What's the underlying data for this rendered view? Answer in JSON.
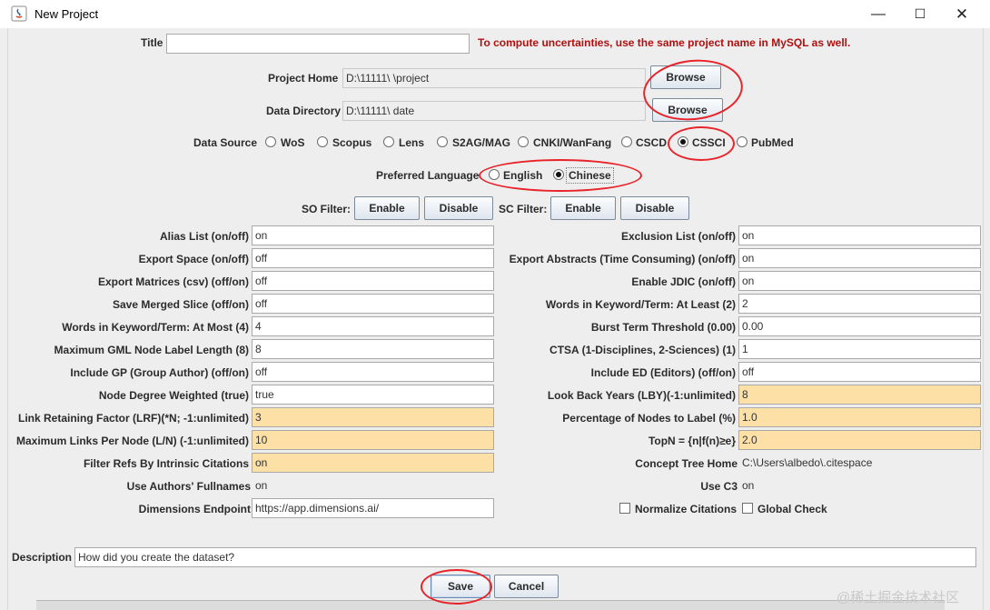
{
  "window": {
    "title": "New Project",
    "minimize_glyph": "—",
    "maximize_glyph": "☐",
    "close_glyph": "✕"
  },
  "header": {
    "title_label": "Title",
    "title_value": "",
    "notice": "To compute uncertainties, use the same project name in MySQL as well.",
    "notice_color": "#b01010",
    "project_home_label": "Project Home",
    "project_home_value": "D:\\11111\\             \\project",
    "data_directory_label": "Data Directory",
    "data_directory_value": "D:\\11111\\             date",
    "browse_label": "Browse"
  },
  "data_source": {
    "label": "Data Source",
    "options": [
      "WoS",
      "Scopus",
      "Lens",
      "S2AG/MAG",
      "CNKI/WanFang",
      "CSCD",
      "CSSCI",
      "PubMed"
    ],
    "selected": "CSSCI"
  },
  "language": {
    "label": "Preferred Language",
    "options": [
      "English",
      "Chinese"
    ],
    "selected": "Chinese"
  },
  "filters": {
    "so_label": "SO Filter:",
    "sc_label": "SC Filter:",
    "enable_label": "Enable",
    "disable_label": "Disable"
  },
  "params_left": [
    {
      "label": "Alias List (on/off)",
      "value": "on"
    },
    {
      "label": "Export Space (on/off)",
      "value": "off"
    },
    {
      "label": "Export Matrices (csv) (off/on)",
      "value": "off"
    },
    {
      "label": "Save Merged Slice (off/on)",
      "value": "off"
    },
    {
      "label": "Words in Keyword/Term: At Most (4)",
      "value": "4"
    },
    {
      "label": "Maximum GML Node Label Length (8)",
      "value": "8"
    },
    {
      "label": "Include GP (Group Author) (off/on)",
      "value": "off"
    },
    {
      "label": "Node Degree Weighted (true)",
      "value": "true"
    },
    {
      "label": "Link Retaining Factor (LRF)(*N; -1:unlimited)",
      "value": "3"
    },
    {
      "label": "Maximum Links Per Node (L/N) (-1:unlimited)",
      "value": "10"
    },
    {
      "label": "Filter Refs By Intrinsic Citations",
      "value": "on"
    },
    {
      "label": "Use Authors' Fullnames",
      "value": "on"
    },
    {
      "label": "Dimensions Endpoint",
      "value": "https://app.dimensions.ai/"
    }
  ],
  "params_right": [
    {
      "label": "Exclusion List (on/off)",
      "value": "on"
    },
    {
      "label": "Export Abstracts (Time Consuming) (on/off)",
      "value": "on"
    },
    {
      "label": "Enable JDIC (on/off)",
      "value": "on"
    },
    {
      "label": "Words in Keyword/Term: At Least (2)",
      "value": "2"
    },
    {
      "label": "Burst Term Threshold (0.00)",
      "value": "0.00"
    },
    {
      "label": "CTSA (1-Disciplines, 2-Sciences) (1)",
      "value": "1"
    },
    {
      "label": "Include ED (Editors) (off/on)",
      "value": "off"
    },
    {
      "label": "Look Back Years (LBY)(-1:unlimited)",
      "value": "8"
    },
    {
      "label": "Percentage of Nodes to Label (%)",
      "value": "1.0"
    },
    {
      "label": "TopN = {n|f(n)≥e}",
      "value": "2.0"
    },
    {
      "label": "Concept Tree Home",
      "value": "C:\\Users\\albedo\\.citespace"
    },
    {
      "label": "Use C3",
      "value": "on"
    }
  ],
  "checkboxes": {
    "normalize_label": "Normalize Citations",
    "global_label": "Global Check"
  },
  "highlight_color": "#fde0a5",
  "description": {
    "label": "Description",
    "value": "How did you create the dataset?"
  },
  "actions": {
    "save_label": "Save",
    "cancel_label": "Cancel"
  },
  "watermark": "@稀土掘金技术社区",
  "annotation_color": "#e8242a"
}
